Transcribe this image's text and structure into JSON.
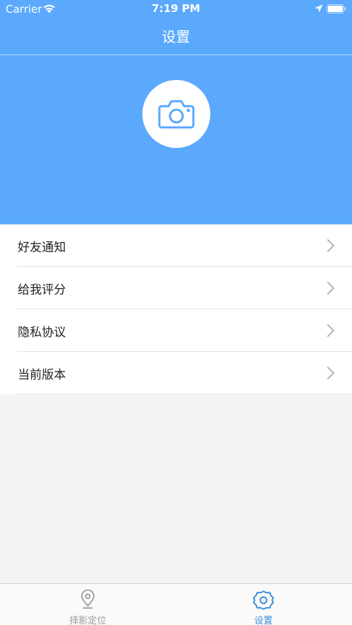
{
  "status_bar": {
    "carrier": "Carrier",
    "time": "7:19 PM"
  },
  "nav": {
    "title": "设置"
  },
  "hero": {
    "avatar_icon": "camera-icon"
  },
  "menu": {
    "items": [
      {
        "label": "好友通知"
      },
      {
        "label": "给我评分"
      },
      {
        "label": "隐私协议"
      },
      {
        "label": "当前版本"
      }
    ]
  },
  "tabbar": {
    "tabs": [
      {
        "label": "择影定位",
        "icon": "location-pin-icon",
        "active": false
      },
      {
        "label": "设置",
        "icon": "gear-icon",
        "active": true
      }
    ]
  },
  "colors": {
    "accent": "#5aa9fd",
    "tab_active": "#3a8fd8",
    "tab_inactive": "#9a9a9a",
    "background": "#f3f3f3"
  }
}
